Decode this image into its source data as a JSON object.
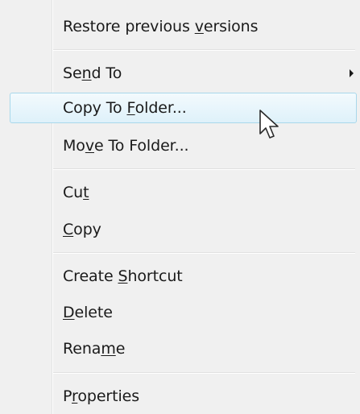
{
  "menu": {
    "items": [
      {
        "id": "restore",
        "before": "Restore previous ",
        "key": "v",
        "after": "ersions"
      },
      {
        "id": "sendto",
        "before": "Se",
        "key": "n",
        "after": "d To"
      },
      {
        "id": "copyto",
        "before": "Copy To ",
        "key": "F",
        "after": "older..."
      },
      {
        "id": "moveto",
        "before": "Mo",
        "key": "v",
        "after": "e To Folder..."
      },
      {
        "id": "cut",
        "before": "Cu",
        "key": "t",
        "after": ""
      },
      {
        "id": "copy",
        "before": "",
        "key": "C",
        "after": "opy"
      },
      {
        "id": "shortcut",
        "before": "Create ",
        "key": "S",
        "after": "hortcut"
      },
      {
        "id": "delete",
        "before": "",
        "key": "D",
        "after": "elete"
      },
      {
        "id": "rename",
        "before": "Rena",
        "key": "m",
        "after": "e"
      },
      {
        "id": "properties",
        "before": "P",
        "key": "r",
        "after": "operties"
      }
    ],
    "highlighted": "Copy To Folder...",
    "submenu_arrow": "right-triangle"
  },
  "cursor": {
    "icon": "mouse-pointer-icon"
  },
  "colors": {
    "menu_bg": "#f0f0f0",
    "highlight_border": "#a8d8eb",
    "highlight_fill": "#def1fa",
    "text": "#1a1a1a"
  }
}
